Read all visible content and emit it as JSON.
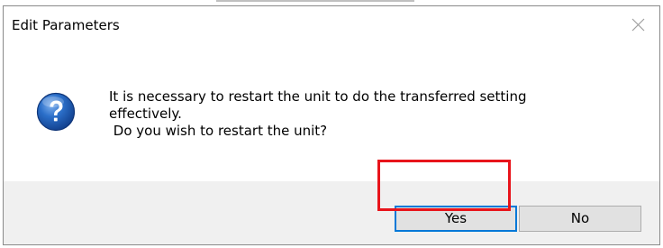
{
  "dialog": {
    "title": "Edit Parameters",
    "close_icon": "close-icon",
    "icon": "question-icon",
    "message_lines": [
      "It is necessary to restart the unit to do the transferred setting",
      "effectively.",
      " Do you wish to restart the unit?"
    ],
    "buttons": {
      "yes_label": "Yes",
      "no_label": "No"
    }
  },
  "colors": {
    "focus_border": "#0078d7",
    "highlight_annotation": "#e8141b",
    "icon_blue": "#1f5fb8"
  }
}
